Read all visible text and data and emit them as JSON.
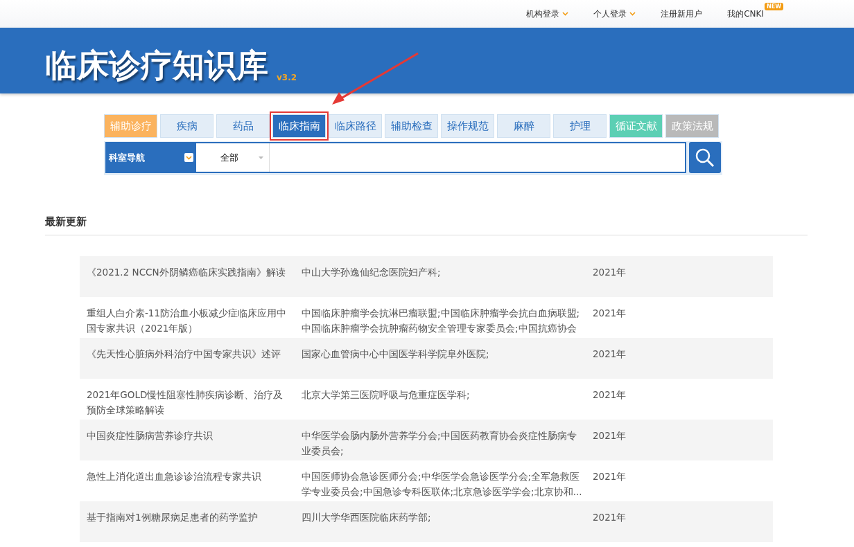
{
  "top_nav": [
    {
      "label": "机构登录",
      "dropdown": true
    },
    {
      "label": "个人登录",
      "dropdown": true
    },
    {
      "label": "注册新用户",
      "dropdown": false
    },
    {
      "label": "我的CNKI",
      "dropdown": false,
      "badge": "NEW"
    }
  ],
  "banner": {
    "title": "临床诊疗知识库",
    "version": "v3.2"
  },
  "tabs": [
    {
      "label": "辅助诊疗",
      "selected": false,
      "color": "#fbb35e",
      "highlighted": false
    },
    {
      "label": "疾病",
      "selected": false,
      "highlighted": false
    },
    {
      "label": "药品",
      "selected": false,
      "highlighted": false
    },
    {
      "label": "临床指南",
      "selected": true,
      "highlighted": true
    },
    {
      "label": "临床路径",
      "selected": false,
      "highlighted": false
    },
    {
      "label": "辅助检查",
      "selected": false,
      "highlighted": false
    },
    {
      "label": "操作规范",
      "selected": false,
      "highlighted": false
    },
    {
      "label": "麻醉",
      "selected": false,
      "highlighted": false
    },
    {
      "label": "护理",
      "selected": false,
      "highlighted": false
    },
    {
      "label": "循证文献",
      "selected": false,
      "color": "#5ccfb4",
      "highlighted": false
    },
    {
      "label": "政策法规",
      "selected": false,
      "color": "#b9b9b9",
      "highlighted": false
    }
  ],
  "search": {
    "nav_label": "科室导航",
    "scope": "全部"
  },
  "latest": {
    "heading": "最新更新",
    "rows": [
      {
        "title": [
          "《2021.2 NCCN外阴鳞癌临床实践指南》解读"
        ],
        "authors": [
          "中山大学孙逸仙纪念医院妇产科;"
        ],
        "year": "2021年"
      },
      {
        "title": [
          "重组人白介素-11防治血小板减少症临床应用中",
          "国专家共识（2021年版）"
        ],
        "authors": [
          "中国临床肿瘤学会抗淋巴瘤联盟;中国临床肿瘤学会抗白血病联盟;",
          "中国临床肿瘤学会抗肿瘤药物安全管理专家委员会;中国抗癌协会"
        ],
        "year": "2021年"
      },
      {
        "title": [
          "《先天性心脏病外科治疗中国专家共识》述评"
        ],
        "authors": [
          "国家心血管病中心中国医学科学院阜外医院;"
        ],
        "year": "2021年"
      },
      {
        "title": [
          "2021年GOLD慢性阻塞性肺疾病诊断、治疗及",
          "预防全球策略解读"
        ],
        "authors": [
          "北京大学第三医院呼吸与危重症医学科;"
        ],
        "year": "2021年"
      },
      {
        "title": [
          "中国炎症性肠病营养诊疗共识"
        ],
        "authors": [
          "中华医学会肠内肠外营养学分会;中国医药教育协会炎症性肠病专",
          "业委员会;"
        ],
        "year": "2021年"
      },
      {
        "title": [
          "急性上消化道出血急诊诊治流程专家共识"
        ],
        "authors": [
          "中国医师协会急诊医师分会;中华医学会急诊医学分会;全军急救医",
          "学专业委员会;中国急诊专科医联体;北京急诊医学学会;北京协和..."
        ],
        "year": "2021年"
      },
      {
        "title": [
          "基于指南对1例糖尿病足患者的药学监护"
        ],
        "authors": [
          "四川大学华西医院临床药学部;"
        ],
        "year": "2021年"
      }
    ]
  }
}
